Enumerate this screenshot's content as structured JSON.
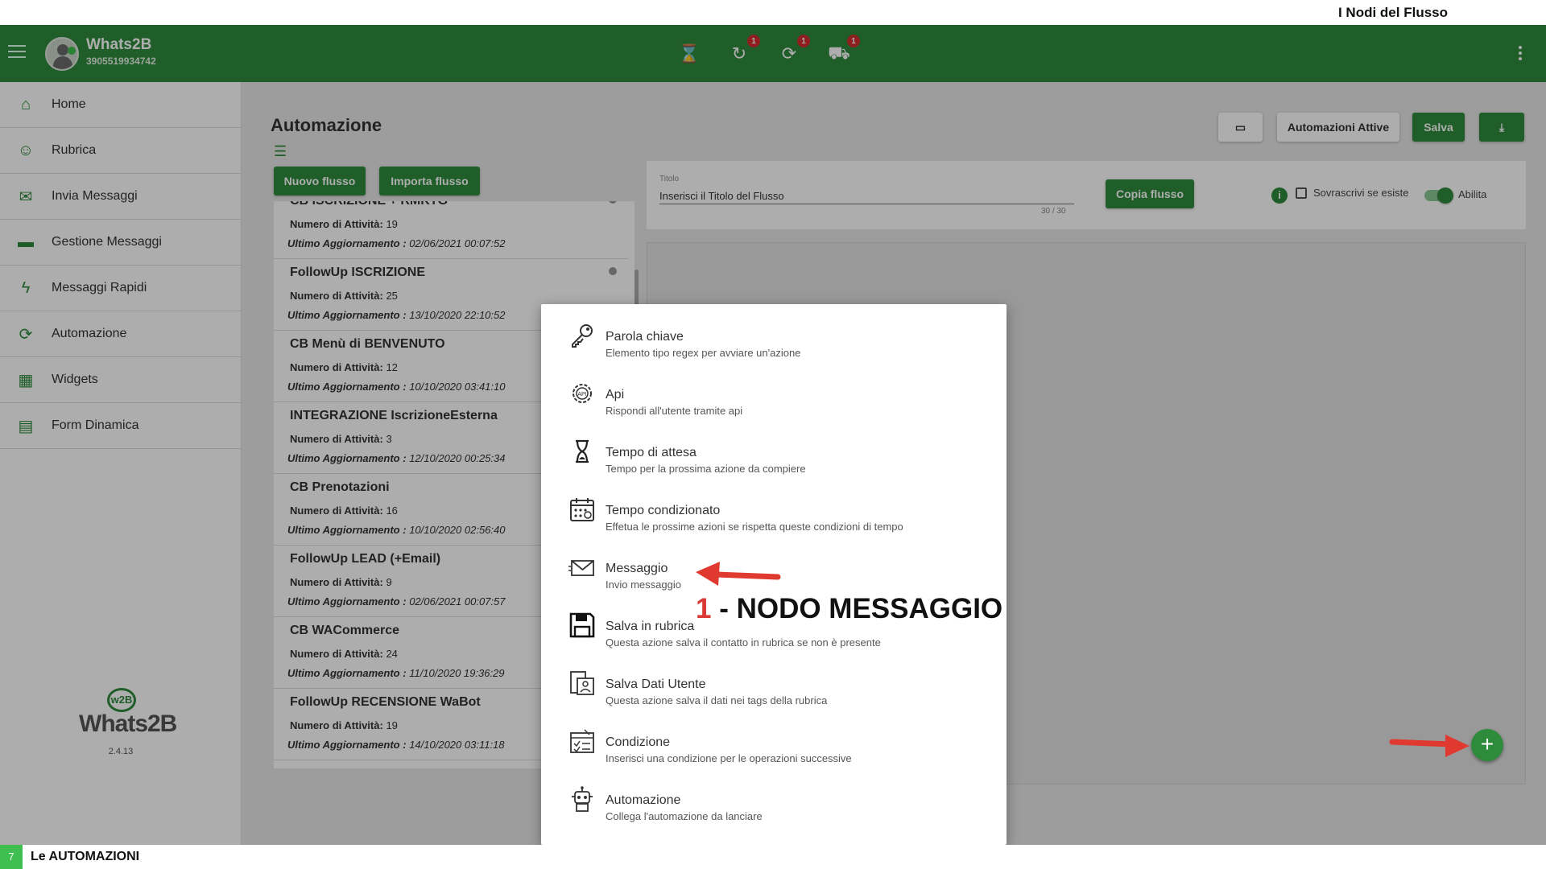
{
  "caption": "I Nodi del Flusso",
  "appbar": {
    "app_name": "Whats2B",
    "phone": "3905519934742",
    "icons": [
      {
        "name": "hourglass-icon",
        "glyph": "⌛",
        "badge": ""
      },
      {
        "name": "history-icon",
        "glyph": "↻",
        "badge": "1"
      },
      {
        "name": "sync-icon",
        "glyph": "⟳",
        "badge": "1"
      },
      {
        "name": "scooter-icon",
        "glyph": "⛟",
        "badge": "1"
      }
    ]
  },
  "sidebar": {
    "items": [
      {
        "label": "Home",
        "icon": "home-icon"
      },
      {
        "label": "Rubrica",
        "icon": "contacts-icon"
      },
      {
        "label": "Invia Messaggi",
        "icon": "envelope-icon"
      },
      {
        "label": "Gestione Messaggi",
        "icon": "folder-icon"
      },
      {
        "label": "Messaggi Rapidi",
        "icon": "lightning-icon"
      },
      {
        "label": "Automazione",
        "icon": "refresh-icon"
      },
      {
        "label": "Widgets",
        "icon": "widgets-icon"
      },
      {
        "label": "Form Dinamica",
        "icon": "form-icon"
      }
    ],
    "logo_mark": "w2B",
    "logo_brand": "Whats2B",
    "version": "2.4.13"
  },
  "main": {
    "title": "Automazione",
    "new_flow_label": "Nuovo flusso",
    "import_flow_label": "Importa flusso",
    "active_automations_label": "Automazioni Attive",
    "save_label": "Salva",
    "count_label": "Numero di Attività:",
    "date_label": "Ultimo Aggiornamento :",
    "flows": [
      {
        "name": "CB ISCRIZIONE + RMKTG",
        "count": "19",
        "date": "02/06/2021 00:07:52"
      },
      {
        "name": "FollowUp ISCRIZIONE",
        "count": "25",
        "date": "13/10/2020 22:10:52"
      },
      {
        "name": "CB Menù di BENVENUTO",
        "count": "12",
        "date": "10/10/2020 03:41:10"
      },
      {
        "name": "INTEGRAZIONE IscrizioneEsterna",
        "count": "3",
        "date": "12/10/2020 00:25:34"
      },
      {
        "name": "CB Prenotazioni",
        "count": "16",
        "date": "10/10/2020 02:56:40"
      },
      {
        "name": "FollowUp LEAD (+Email)",
        "count": "9",
        "date": "02/06/2021 00:07:57"
      },
      {
        "name": "CB WACommerce",
        "count": "24",
        "date": "11/10/2020 19:36:29"
      },
      {
        "name": "FollowUp RECENSIONE WaBot",
        "count": "19",
        "date": "14/10/2020 03:11:18"
      }
    ]
  },
  "title_card": {
    "label": "Titolo",
    "value": "Inserisci il Titolo del Flusso",
    "counter": "30 / 30",
    "copy_label": "Copia flusso",
    "overwrite_label": "Sovrascrivi se esiste",
    "enable_label": "Abilita"
  },
  "menu": {
    "items": [
      {
        "title": "Parola chiave",
        "desc": "Elemento tipo regex per avviare un'azione",
        "icon": "key-icon"
      },
      {
        "title": "Api",
        "desc": "Rispondi all'utente tramite api",
        "icon": "api-gear-icon"
      },
      {
        "title": "Tempo di attesa",
        "desc": "Tempo per la prossima azione da compiere",
        "icon": "hourglass-icon"
      },
      {
        "title": "Tempo condizionato",
        "desc": "Effetua le prossime azioni se rispetta queste condizioni di tempo",
        "icon": "calendar-icon"
      },
      {
        "title": "Messaggio",
        "desc": "Invio messaggio",
        "icon": "envelope-icon"
      },
      {
        "title": "Salva in rubrica",
        "desc": "Questa azione salva il contatto in rubrica se non è presente",
        "icon": "floppy-icon"
      },
      {
        "title": "Salva Dati Utente",
        "desc": "Questa azione salva il dati nei tags della rubrica",
        "icon": "user-data-icon"
      },
      {
        "title": "Condizione",
        "desc": "Inserisci una condizione per le operazioni successive",
        "icon": "condition-icon"
      },
      {
        "title": "Automazione",
        "desc": "Collega l'automazione da lanciare",
        "icon": "robot-icon"
      }
    ]
  },
  "annotation": {
    "number": "1",
    "text": " - NODO MESSAGGIO"
  },
  "footer": {
    "page": "7",
    "title": "Le AUTOMAZIONI"
  },
  "colors": {
    "brand_green": "#2e8b3b",
    "annotation_red": "#d93a34",
    "badge_red": "#d32f2f"
  }
}
